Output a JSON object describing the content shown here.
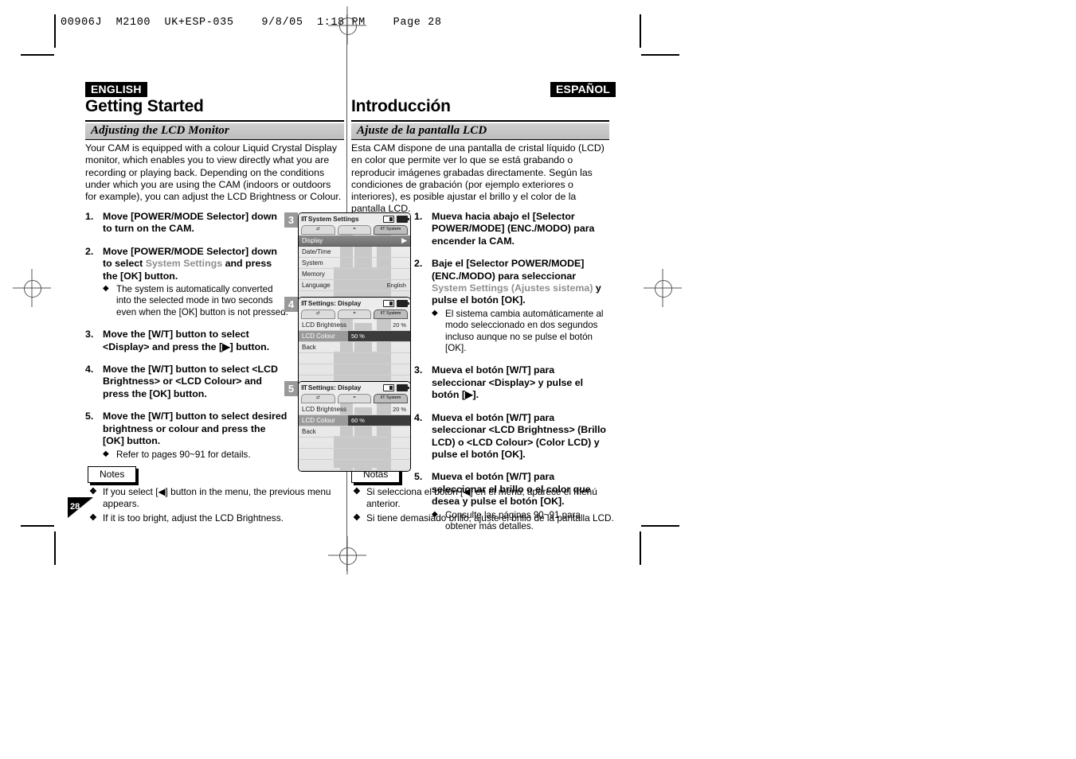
{
  "print_slug": "00906J  M2100  UK+ESP-035    9/8/05  1:18 PM    Page 28",
  "page_number": "28",
  "english": {
    "lang_badge": "ENGLISH",
    "chapter_title": "Getting Started",
    "section_title": "Adjusting the LCD Monitor",
    "intro": "Your CAM is equipped with a colour Liquid Crystal Display monitor, which enables you to view directly what you are recording or playing back. Depending on the conditions under which you are using the CAM (indoors or outdoors for example), you can adjust the LCD Brightness or Colour.",
    "steps": [
      {
        "num": "1.",
        "text_before": "Move [POWER/MODE Selector] down to turn on the CAM.",
        "grey": "",
        "text_after": "",
        "subs": []
      },
      {
        "num": "2.",
        "text_before": "Move [POWER/MODE Selector] down to select ",
        "grey": "System Settings",
        "text_after": " and press the [OK] button.",
        "subs": [
          "The system is automatically converted into the selected mode in two seconds even when the [OK] button is not pressed."
        ]
      },
      {
        "num": "3.",
        "text_before": "Move the [W/T] button to select <Display> and press the [▶] button.",
        "grey": "",
        "text_after": "",
        "subs": []
      },
      {
        "num": "4.",
        "text_before": "Move the [W/T] button to select <LCD Brightness> or <LCD Colour> and press the [OK] button.",
        "grey": "",
        "text_after": "",
        "subs": []
      },
      {
        "num": "5.",
        "text_before": "Move the [W/T] button to select desired brightness or colour and press the [OK] button.",
        "grey": "",
        "text_after": "",
        "subs": [
          "Refer to pages 90~91 for details."
        ]
      }
    ],
    "notes_label": "Notes",
    "notes": [
      "If you select [◀] button in the menu, the previous menu appears.",
      "If it is too bright, adjust the LCD Brightness."
    ]
  },
  "spanish": {
    "lang_badge": "ESPAÑOL",
    "chapter_title": "Introducción",
    "section_title": "Ajuste de la pantalla LCD",
    "intro": "Esta CAM dispone de una pantalla de cristal líquido (LCD) en color que permite ver lo que se está grabando o reproducir imágenes grabadas directamente. Según las condiciones de grabación (por ejemplo exteriores o interiores), es posible ajustar el brillo y el color de la pantalla LCD.",
    "steps": [
      {
        "num": "1.",
        "text_before": "Mueva hacia abajo el [Selector POWER/MODE] (ENC./MODO) para encender la CAM.",
        "grey": "",
        "text_after": "",
        "subs": []
      },
      {
        "num": "2.",
        "text_before": "Baje el [Selector POWER/MODE] (ENC./MODO) para seleccionar ",
        "grey": "System Settings (Ajustes sistema)",
        "text_after": " y pulse el botón [OK].",
        "subs": [
          "El sistema cambia automáticamente al modo seleccionado en dos segundos incluso aunque no se pulse el botón [OK]."
        ]
      },
      {
        "num": "3.",
        "text_before": "Mueva el botón [W/T] para seleccionar <Display> y pulse el botón [▶].",
        "grey": "",
        "text_after": "",
        "subs": []
      },
      {
        "num": "4.",
        "text_before": "Mueva el botón [W/T] para seleccionar <LCD Brightness> (Brillo LCD) o <LCD Colour> (Color LCD) y pulse el botón [OK].",
        "grey": "",
        "text_after": "",
        "subs": []
      },
      {
        "num": "5.",
        "text_before": "Mueva el botón [W/T] para seleccionar el brillo o el color que desea y pulse el botón [OK].",
        "grey": "",
        "text_after": "",
        "subs": [
          "Consulte las páginas 90~91 para obtener más detalles."
        ]
      }
    ],
    "notes_label": "Notas",
    "notes": [
      "Si selecciona el botón [◀] en el menú, aparece el menú anterior.",
      "Si tiene demasiado brillo, ajuste el brillo de la pantalla LCD."
    ]
  },
  "figures": [
    {
      "step_number": "3",
      "title": "System Settings",
      "mode_icon": "system-mode-icon",
      "tabs": [
        {
          "label": "",
          "icon": "record-tab-icon",
          "active": false
        },
        {
          "label": "",
          "icon": "playback-tab-icon",
          "active": false
        },
        {
          "label": "System",
          "icon": "system-tab-icon",
          "active": true
        }
      ],
      "rows": [
        {
          "label": "Display",
          "value": "",
          "style": "highlight",
          "arrow": "▶"
        },
        {
          "label": "Date/Time",
          "value": "",
          "style": "normal"
        },
        {
          "label": "System",
          "value": "",
          "style": "normal"
        },
        {
          "label": "Memory",
          "value": "",
          "style": "normal"
        },
        {
          "label": "Language",
          "value": "English",
          "style": "normal"
        },
        {
          "label": "",
          "value": "",
          "style": "blank"
        }
      ]
    },
    {
      "step_number": "4",
      "title": "Settings: Display",
      "mode_icon": "system-mode-icon",
      "tabs": [
        {
          "label": "",
          "icon": "record-tab-icon",
          "active": false
        },
        {
          "label": "",
          "icon": "playback-tab-icon",
          "active": false
        },
        {
          "label": "System",
          "icon": "system-tab-icon",
          "active": true
        }
      ],
      "rows": [
        {
          "label": "LCD Brightness",
          "value": "20 %",
          "style": "normal"
        },
        {
          "label": "LCD Colour",
          "value": "50 %",
          "style": "valbar"
        },
        {
          "label": "Back",
          "value": "",
          "style": "normal"
        },
        {
          "label": "",
          "value": "",
          "style": "blank"
        },
        {
          "label": "",
          "value": "",
          "style": "blank"
        },
        {
          "label": "",
          "value": "",
          "style": "blank"
        }
      ]
    },
    {
      "step_number": "5",
      "title": "Settings: Display",
      "mode_icon": "system-mode-icon",
      "tabs": [
        {
          "label": "",
          "icon": "record-tab-icon",
          "active": false
        },
        {
          "label": "",
          "icon": "playback-tab-icon",
          "active": false
        },
        {
          "label": "System",
          "icon": "system-tab-icon",
          "active": true
        }
      ],
      "rows": [
        {
          "label": "LCD Brightness",
          "value": "20 %",
          "style": "normal"
        },
        {
          "label": "LCD Colour",
          "value": "60 %",
          "style": "valbar"
        },
        {
          "label": "Back",
          "value": "",
          "style": "normal"
        },
        {
          "label": "",
          "value": "",
          "style": "blank"
        },
        {
          "label": "",
          "value": "",
          "style": "blank"
        },
        {
          "label": "",
          "value": "",
          "style": "blank"
        }
      ]
    }
  ]
}
